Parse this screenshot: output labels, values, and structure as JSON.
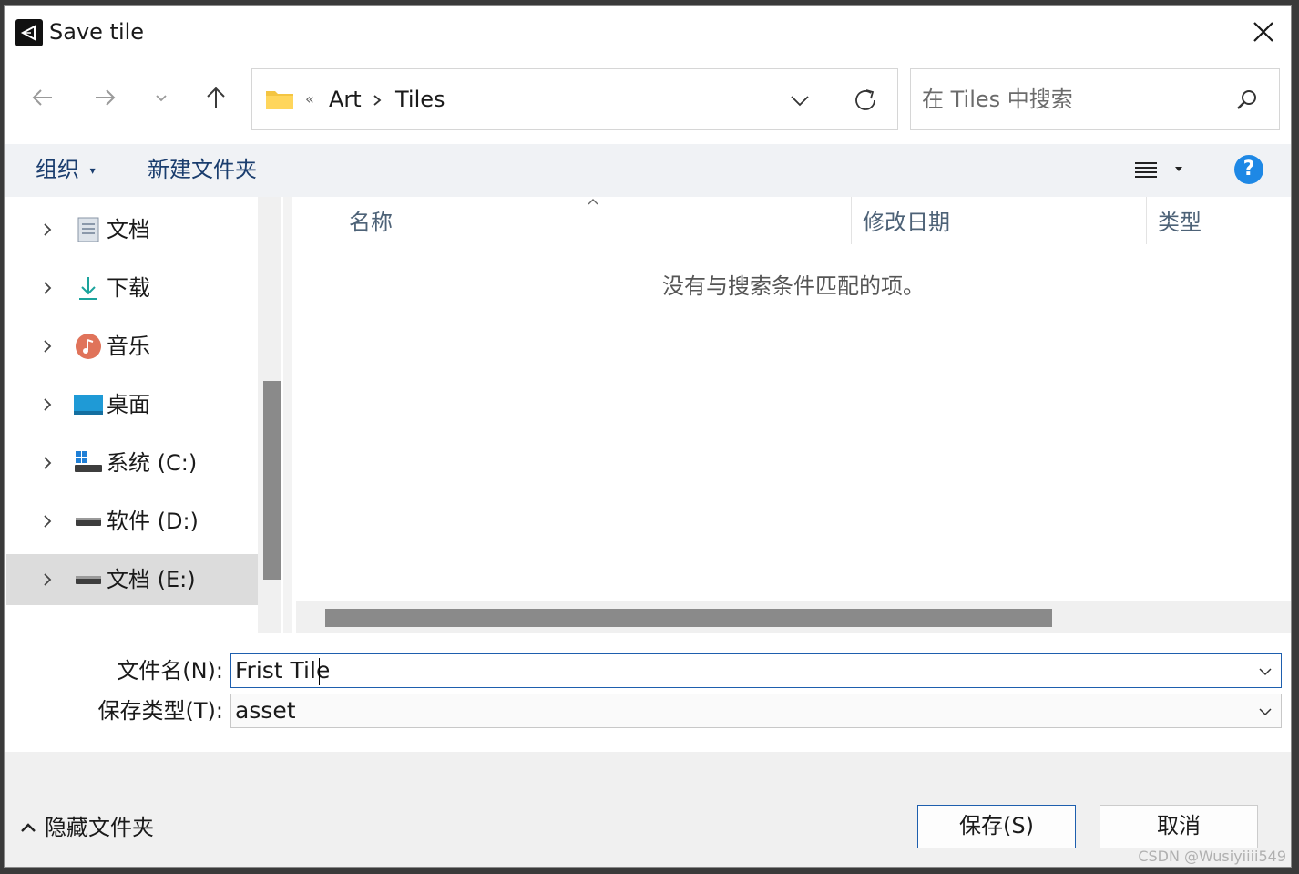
{
  "window": {
    "title": "Save tile"
  },
  "address": {
    "overflow": "«",
    "crumbs": [
      "Art",
      "Tiles"
    ]
  },
  "search": {
    "placeholder": "在 Tiles 中搜索"
  },
  "toolbar": {
    "organize": "组织",
    "new_folder": "新建文件夹"
  },
  "sidebar": {
    "items": [
      {
        "label": "文档",
        "icon": "documents-icon"
      },
      {
        "label": "下载",
        "icon": "download-icon"
      },
      {
        "label": "音乐",
        "icon": "music-icon"
      },
      {
        "label": "桌面",
        "icon": "desktop-icon"
      },
      {
        "label": "系统 (C:)",
        "icon": "windows-drive-icon"
      },
      {
        "label": "软件 (D:)",
        "icon": "drive-icon"
      },
      {
        "label": "文档 (E:)",
        "icon": "drive-icon",
        "selected": true
      }
    ]
  },
  "columns": [
    "名称",
    "修改日期",
    "类型"
  ],
  "empty_message": "没有与搜索条件匹配的项。",
  "form": {
    "filename_label": "文件名(N):",
    "filename_value": "Frist Tile",
    "filetype_label": "保存类型(T):",
    "filetype_value": "asset"
  },
  "footer": {
    "hide_folders": "隐藏文件夹",
    "save": "保存(S)",
    "cancel": "取消"
  },
  "watermark": "CSDN @Wusiyiiii549",
  "colors": {
    "accent": "#1e5fae",
    "help": "#1e88e5",
    "link": "#1a3d6e"
  }
}
